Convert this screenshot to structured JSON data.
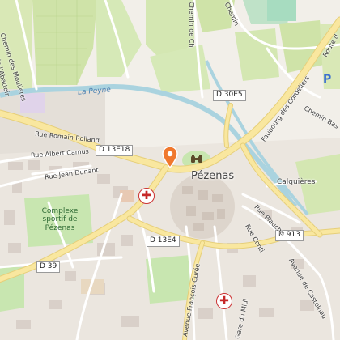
{
  "map": {
    "town": "Pézenas",
    "places": {
      "calquieres": "Calquières"
    },
    "water": {
      "peyne": "La Peyne"
    },
    "parks": {
      "complexe": "Complexe sportif de Pézenas"
    },
    "road_shields": {
      "d30e5": "D 30E5",
      "d13e18": "D 13E18",
      "d13e4": "D 13E4",
      "d39": "D 39",
      "d913": "D 913"
    },
    "streets": {
      "romain_rolland": "Rue Romain Rolland",
      "albert_camus": "Rue Albert Camus",
      "jean_dunant": "Rue Jean Dunant",
      "chemin_moulieres": "Chemin des Moulières",
      "chemin_abattoir": "de l'Abattoir",
      "chemin_ch": "Chemin de Ch",
      "chemin_top": "Chemin",
      "faubourg_cordeliers": "Faubourg des Cordeliers",
      "route_top": "Route d",
      "chemin_bas": "Chemin Bas",
      "rue_plauche": "Rue Plauche",
      "rue_conti": "Rue Conti",
      "avenue_castelnau": "Avenue de Castelnau",
      "avenue_francois_curee": "Avenue François Curée",
      "gare_midi": "Gare du Midi"
    },
    "icons": {
      "pin": "map-pin-icon",
      "binoculars": "binoculars-icon",
      "health": "health-cross-icon",
      "parking": "parking-icon"
    },
    "icon_glyphs": {
      "health": "✚",
      "parking": "P",
      "binoculars": "👓"
    },
    "colors": {
      "background": "#f2efe9",
      "park": "#c8e6b0",
      "water": "#aad3df",
      "major_road": "#f9e79f",
      "pin": "#f0782d",
      "health": "#c62828"
    }
  }
}
